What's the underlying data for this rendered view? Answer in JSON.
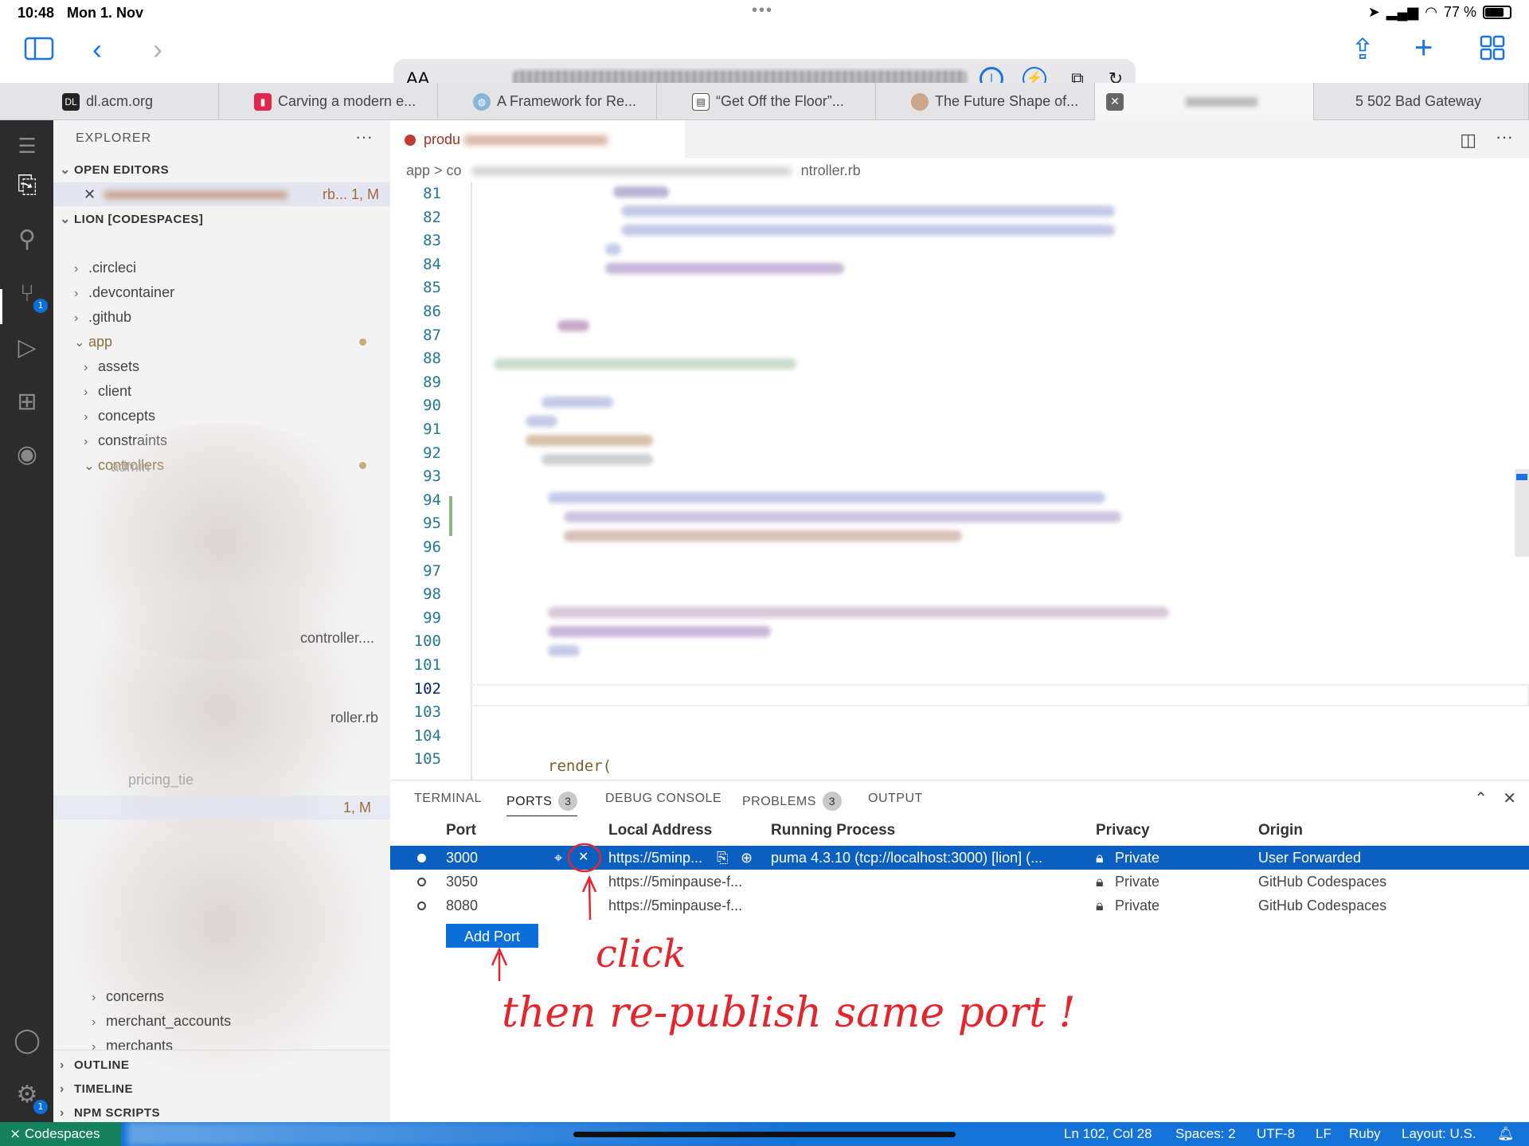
{
  "status_bar": {
    "time": "10:48",
    "date": "Mon 1. Nov",
    "battery": "77 %",
    "battery_level": 0.77
  },
  "browser": {
    "aa_label": "AA",
    "tabs": [
      {
        "label": "dl.acm.org",
        "icon": "acm-dl-icon"
      },
      {
        "label": "Carving a modern e...",
        "icon": "red-page-icon"
      },
      {
        "label": "A Framework for Re...",
        "icon": "globe-icon"
      },
      {
        "label": "“Get Off the Floor”...",
        "icon": "document-icon"
      },
      {
        "label": "The Future Shape of...",
        "icon": "avatar-icon"
      },
      {
        "label": "",
        "icon": "close-icon"
      },
      {
        "label": "5  502 Bad Gateway",
        "icon": "number-icon"
      }
    ]
  },
  "vscode": {
    "explorer_title": "EXPLORER",
    "open_editors_label": "OPEN EDITORS",
    "open_editor_suffix": "rb... 1, M",
    "workspace_label": "LION [CODESPACES]",
    "tree": [
      {
        "label": ".circleci",
        "indent": 1,
        "chev": "›"
      },
      {
        "label": ".devcontainer",
        "indent": 1,
        "chev": "›"
      },
      {
        "label": ".github",
        "indent": 1,
        "chev": "›"
      },
      {
        "label": "app",
        "indent": 1,
        "chev": "⌄",
        "modified": true
      },
      {
        "label": "assets",
        "indent": 2,
        "chev": "›"
      },
      {
        "label": "client",
        "indent": 2,
        "chev": "›"
      },
      {
        "label": "concepts",
        "indent": 2,
        "chev": "›"
      },
      {
        "label": "constraints",
        "indent": 2,
        "chev": "›"
      },
      {
        "label": "controllers",
        "indent": 2,
        "chev": "⌄",
        "modified": true
      }
    ],
    "tree_bottom": [
      {
        "label": "concerns",
        "chev": "›"
      },
      {
        "label": "merchant_accounts",
        "chev": "›"
      },
      {
        "label": "merchants",
        "chev": "›"
      }
    ],
    "tree_fragments": {
      "controller": "controller....",
      "roller": "roller.rb",
      "pricing": "pricing_tie",
      "modified_label": "1, M",
      "admin": "admin"
    },
    "outline_label": "OUTLINE",
    "timeline_label": "TIMELINE",
    "npm_label": "NPM SCRIPTS",
    "editor_tab": "produ",
    "breadcrumb": "app > co",
    "breadcrumb_tail": "ntroller.rb",
    "line_numbers": [
      "81",
      "82",
      "83",
      "84",
      "85",
      "86",
      "87",
      "88",
      "89",
      "90",
      "91",
      "92",
      "93",
      "94",
      "95",
      "96",
      "97",
      "98",
      "99",
      "100",
      "101",
      "102",
      "103",
      "104",
      "105"
    ],
    "current_line": "102",
    "render_text": "render(",
    "panel": {
      "tabs": [
        {
          "label": "TERMINAL"
        },
        {
          "label": "PORTS",
          "count": "3",
          "active": true
        },
        {
          "label": "DEBUG CONSOLE"
        },
        {
          "label": "PROBLEMS",
          "count": "3"
        },
        {
          "label": "OUTPUT"
        }
      ],
      "columns": [
        "Port",
        "Local Address",
        "Running Process",
        "Privacy",
        "Origin"
      ],
      "rows": [
        {
          "port": "3000",
          "address": "https://5minp...",
          "process": "puma 4.3.10 (tcp://localhost:3000) [lion] (...",
          "privacy": "Private",
          "origin": "User Forwarded",
          "selected": true
        },
        {
          "port": "3050",
          "address": "https://5minpause-f...",
          "process": "",
          "privacy": "Private",
          "origin": "GitHub Codespaces"
        },
        {
          "port": "8080",
          "address": "https://5minpause-f...",
          "process": "",
          "privacy": "Private",
          "origin": "GitHub Codespaces"
        }
      ],
      "add_port_label": "Add Port"
    },
    "status": {
      "remote": "Codespaces",
      "position": "Ln 102, Col 28",
      "spaces": "Spaces: 2",
      "encoding": "UTF-8",
      "eol": "LF",
      "language": "Ruby",
      "layout": "Layout: U.S."
    }
  },
  "annotations": {
    "click": "click",
    "instruction": "then re-publish same port !"
  },
  "colors": {
    "accent": "#0a6fd8",
    "selection": "#0a5fc1",
    "annotation": "#e3262d",
    "remote": "#16825d"
  }
}
